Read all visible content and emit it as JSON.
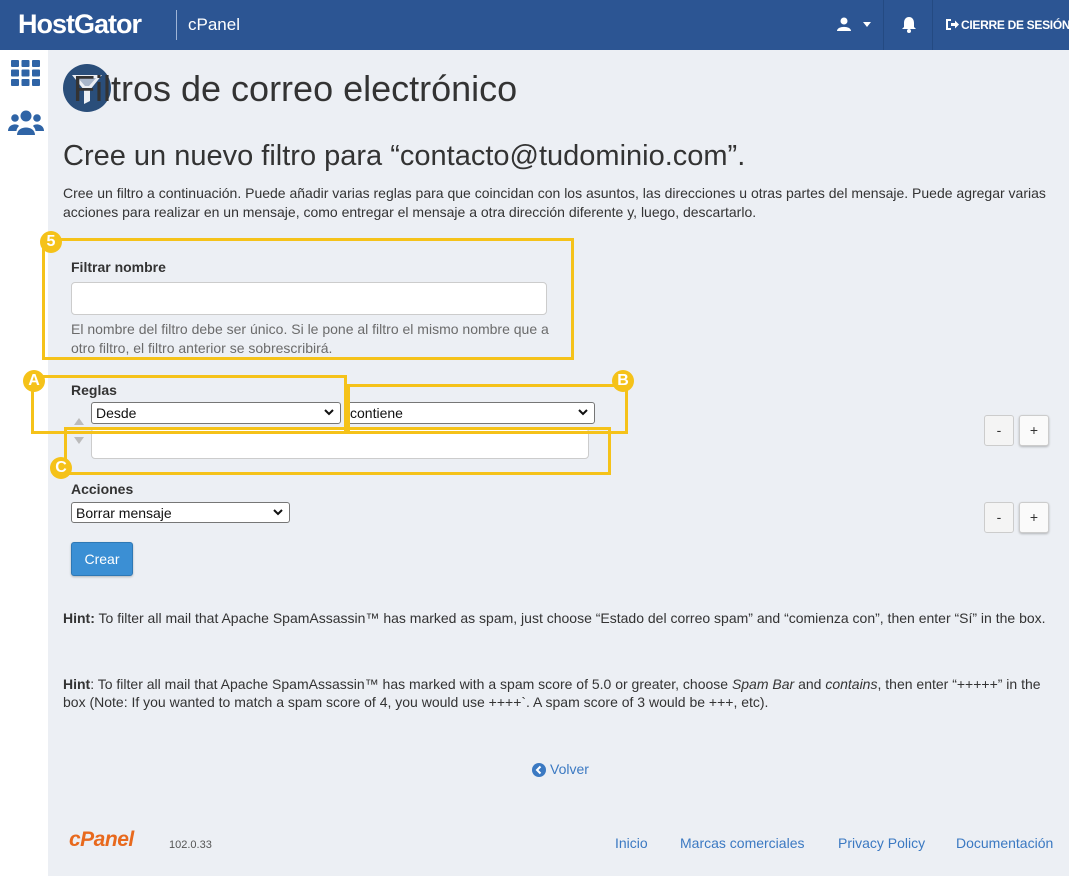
{
  "header": {
    "brand": "HostGator",
    "product": "cPanel",
    "user_icon": "user-icon",
    "bell_icon": "bell-icon",
    "logout_label": "CIERRE DE SESIÓN"
  },
  "sidebar": {
    "items": [
      {
        "icon": "grid-icon"
      },
      {
        "icon": "users-icon"
      }
    ]
  },
  "page": {
    "title": "Filtros de correo electrónico",
    "icon": "funnel-icon",
    "subtitle": "Cree un nuevo filtro para “contacto@tudominio.com”.",
    "description": "Cree un filtro a continuación. Puede añadir varias reglas para que coincidan con los asuntos, las direcciones u otras partes del mensaje. Puede agregar varias acciones para realizar en un mensaje, como entregar el mensaje a otra dirección diferente y, luego, descartarlo."
  },
  "form": {
    "filter_name_label": "Filtrar nombre",
    "filter_name_value": "",
    "filter_name_help": "El nombre del filtro debe ser único. Si le pone al filtro el mismo nombre que a otro filtro, el filtro anterior se sobrescribirá.",
    "rules_label": "Reglas",
    "rule_field_selected": "Desde",
    "rule_operator_selected": "contiene",
    "rule_value": "",
    "actions_label": "Acciones",
    "action_selected": "Borrar mensaje",
    "minus_label": "-",
    "plus_label": "+",
    "create_label": "Crear"
  },
  "hints": {
    "hint_label": "Hint:",
    "hint1_text": " To filter all mail that Apache SpamAssassin™ has marked as spam, just choose “Estado del correo spam” and “comienza con”, then enter “Sí” in the box.",
    "hint2_text": ": To filter all mail that Apache SpamAssassin™ has marked with a spam score of 5.0 or greater, choose ",
    "hint2_spam_bar": "Spam Bar",
    "hint2_and": " and ",
    "hint2_contains": "contains",
    "hint2_rest": ", then enter “+++++” in the box (Note: If you wanted to match a spam score of 4, you would use ++++`. A spam score of 3 would be +++, etc).",
    "hint2_label": "Hint"
  },
  "back_link": "Volver",
  "annotations": {
    "badge_5": "5",
    "badge_a": "A",
    "badge_b": "B",
    "badge_c": "C",
    "color": "#f5c219"
  },
  "footer": {
    "logo": "cPanel",
    "version": "102.0.33",
    "links": [
      "Inicio",
      "Marcas comerciales",
      "Privacy Policy",
      "Documentación"
    ]
  },
  "colors": {
    "header_bg": "#2c5593",
    "accent": "#3b8fd4",
    "link": "#3b79c2",
    "cpanel_orange": "#e8691d"
  }
}
